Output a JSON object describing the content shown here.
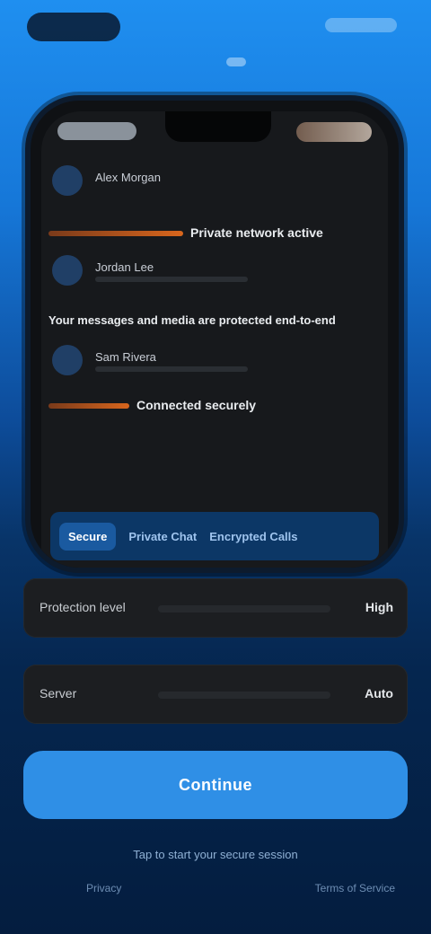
{
  "phone": {
    "thread": {
      "rows": [
        {
          "sender": "Alex Morgan"
        },
        {
          "sender": "Jordan Lee"
        },
        {
          "sender": "Sam Rivera"
        }
      ],
      "headlines": [
        "Private network active",
        "Your messages and media are protected end-to-end",
        "Connected securely"
      ]
    },
    "tabs": [
      "Secure",
      "Private Chat",
      "Encrypted Calls"
    ]
  },
  "fields": [
    {
      "label": "Protection level",
      "value": "High"
    },
    {
      "label": "Server",
      "value": "Auto"
    }
  ],
  "cta_label": "Continue",
  "subtext": "Tap to start your secure session",
  "footer": {
    "left": "Privacy",
    "right": "Terms of Service"
  }
}
